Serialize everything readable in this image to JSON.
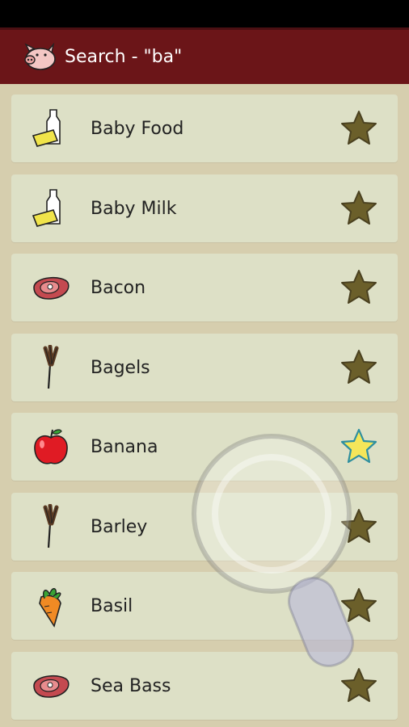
{
  "header": {
    "title": "Search - \"ba\"",
    "logo_icon": "pig-icon"
  },
  "items": [
    {
      "label": "Baby Food",
      "icon": "dairy-icon",
      "favorite": false
    },
    {
      "label": "Baby Milk",
      "icon": "dairy-icon",
      "favorite": false
    },
    {
      "label": "Bacon",
      "icon": "meat-icon",
      "favorite": false
    },
    {
      "label": "Bagels",
      "icon": "grain-icon",
      "favorite": false
    },
    {
      "label": "Banana",
      "icon": "fruit-icon",
      "favorite": true
    },
    {
      "label": "Barley",
      "icon": "grain-icon",
      "favorite": false
    },
    {
      "label": "Basil",
      "icon": "vegetable-icon",
      "favorite": false
    },
    {
      "label": "Sea Bass",
      "icon": "meat-icon",
      "favorite": false
    }
  ],
  "colors": {
    "action_bar": "#6b1518",
    "background": "#d6ceae",
    "card": "#dde0c6",
    "star_inactive": "#6b5f2a",
    "star_active": "#f5e65a"
  }
}
